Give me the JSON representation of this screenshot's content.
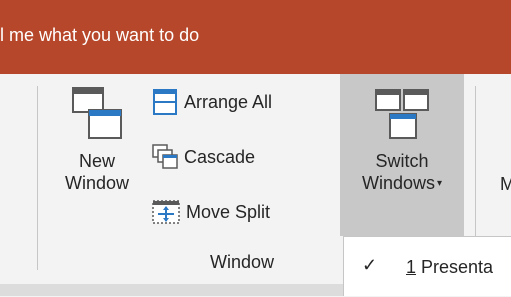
{
  "ribbon": {
    "tell_me": "l me what you want to do",
    "new_window": {
      "line1": "New",
      "line2": "Window"
    },
    "arrange_all": "Arrange All",
    "cascade": "Cascade",
    "move_split": "Move Split",
    "switch_windows": {
      "line1": "Switch",
      "line2": "Windows"
    },
    "more_partial": "M",
    "group_window": "Window"
  },
  "dropdown": {
    "items": [
      {
        "accel": "1",
        "label": " Presenta",
        "checked": true
      }
    ]
  },
  "colors": {
    "title_bar": "#b7472a",
    "ribbon_bg": "#f3f3f3",
    "accent_blue": "#2b78c5"
  }
}
